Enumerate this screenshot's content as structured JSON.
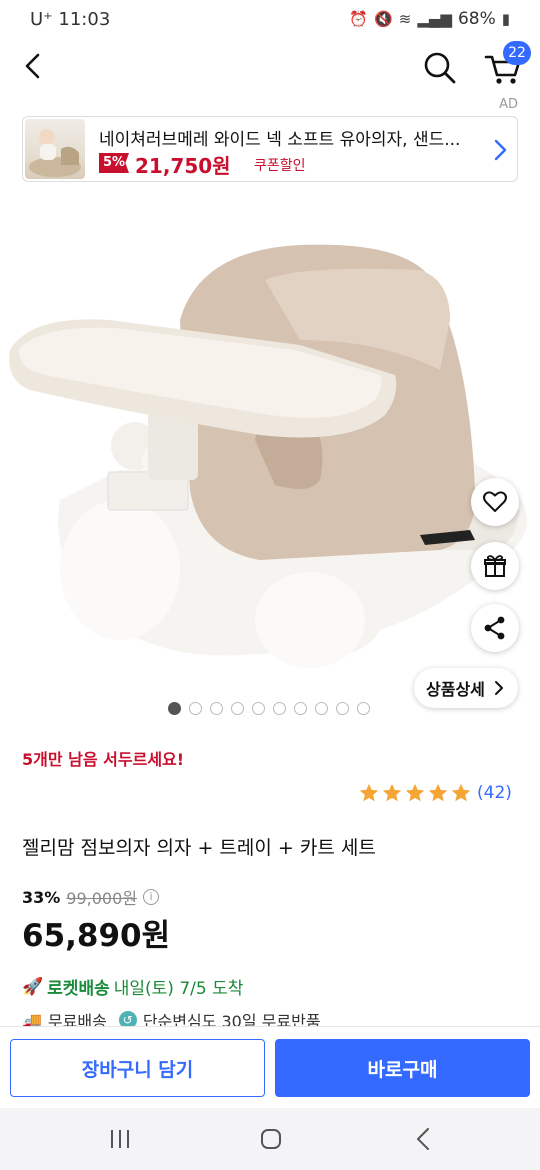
{
  "status_bar": {
    "carrier_time": "U⁺ 11:03",
    "battery": "68%"
  },
  "header": {
    "cart_count": "22"
  },
  "ad": {
    "label": "AD",
    "title": "네이쳐러브메레 와이드 넥 소프트 유아의자, 샌드...",
    "discount": "5%",
    "price": "21,750원",
    "coupon": "쿠폰할인"
  },
  "gallery": {
    "detail_label": "상품상세",
    "total_images": 10,
    "active_index": 0
  },
  "product": {
    "urgency": "5개만 남음 서두르세요!",
    "rating_stars": 5,
    "review_count": "(42)",
    "title": "젤리맘 점보의자 의자 + 트레이 + 카트 세트",
    "discount_rate": "33%",
    "original_price": "99,000원",
    "sale_price": "65,890원",
    "rocket_label": "로켓배송",
    "delivery_date": "내일(토) 7/5 도착",
    "free_shipping": "무료배송",
    "return_policy": "단순변심도 30일 무료반품"
  },
  "actions": {
    "add_to_cart": "장바구니 담기",
    "buy_now": "바로구매"
  },
  "colors": {
    "accent": "#346aff",
    "sale_red": "#c8102e",
    "rocket_green": "#1b8a3a",
    "star": "#f4a534"
  }
}
